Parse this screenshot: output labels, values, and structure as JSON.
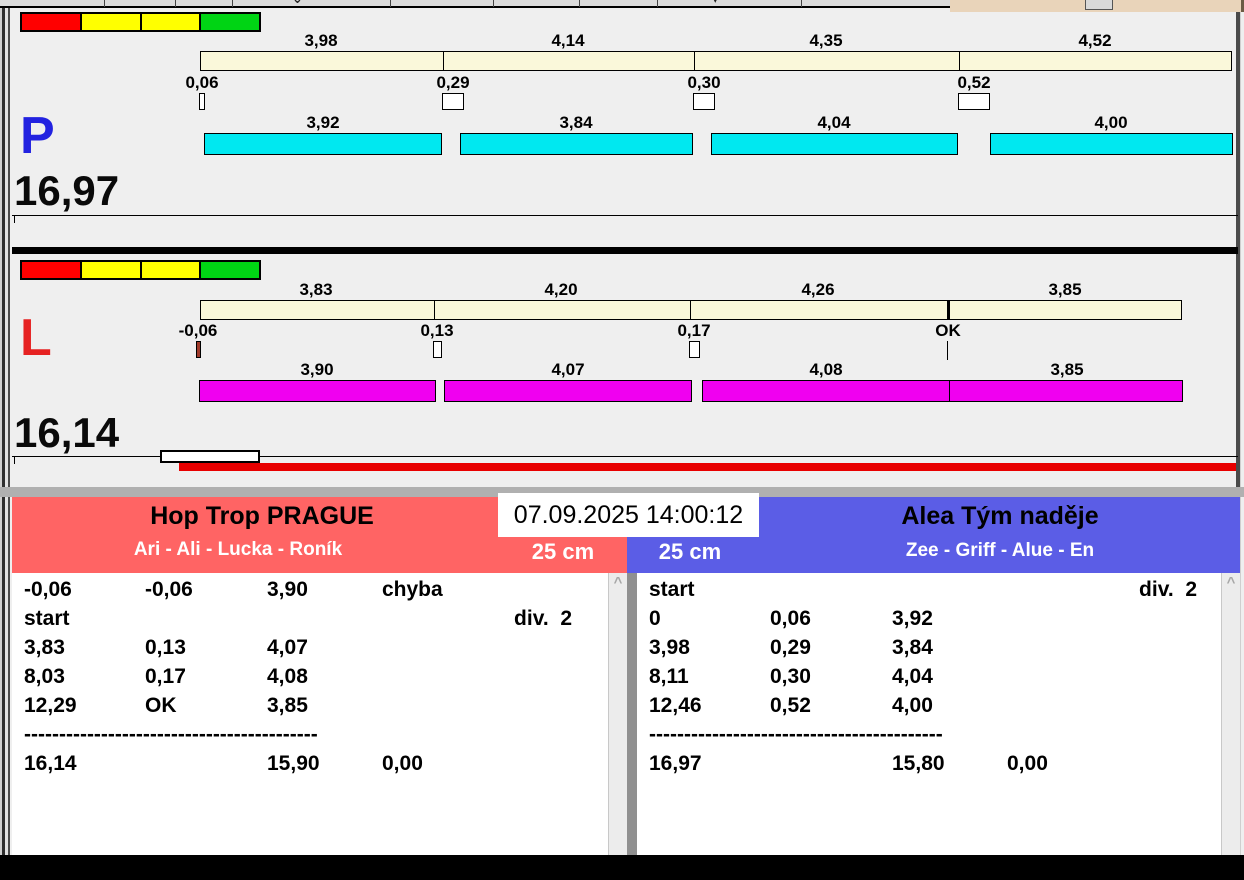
{
  "colors": {
    "upper_bar": "#faf8da",
    "lane_p_bar": "#00e8f0",
    "lane_l_bar": "#f000f0",
    "lane_p_letter": "#2222e0",
    "lane_l_letter": "#e62222",
    "team_left_bg": "#ff6464",
    "team_right_bg": "#5b5de6",
    "traffic_lights": [
      "#ff0000",
      "#ffff00",
      "#ffff00",
      "#00d414"
    ],
    "progress_bar_red": "#e80000",
    "negative_exchange_fill": "#a03a2a"
  },
  "lanes": [
    {
      "letter": "P",
      "total": "16,97",
      "upper_segments": [
        "3,98",
        "4,14",
        "4,35",
        "4,52"
      ],
      "exchanges": [
        "0,06",
        "0,29",
        "0,30",
        "0,52"
      ],
      "lower_segments": [
        "3,92",
        "3,84",
        "4,04",
        "4,00"
      ]
    },
    {
      "letter": "L",
      "total": "16,14",
      "upper_segments": [
        "3,83",
        "4,20",
        "4,26",
        "3,85"
      ],
      "exchanges": [
        "-0,06",
        "0,13",
        "0,17",
        "OK"
      ],
      "lower_segments": [
        "3,90",
        "4,07",
        "4,08",
        "3,85"
      ]
    }
  ],
  "datetime": "07.09.2025 14:00:12",
  "teams": [
    {
      "name": "Hop Trop PRAGUE",
      "members": "Ari - Ali - Lucka - Roník",
      "distance": "25 cm",
      "rows": [
        [
          "-0,06",
          "-0,06",
          "3,90",
          "chyba",
          ""
        ],
        [
          "start",
          "",
          "",
          "",
          "div.  2"
        ],
        [
          "3,83",
          "0,13",
          "4,07",
          "",
          ""
        ],
        [
          "8,03",
          "0,17",
          "4,08",
          "",
          ""
        ],
        [
          "12,29",
          "OK",
          "3,85",
          "",
          ""
        ],
        [
          "------------------------------------------",
          "",
          "",
          "",
          ""
        ],
        [
          "16,14",
          "",
          "15,90",
          "0,00",
          ""
        ]
      ]
    },
    {
      "name": "Alea Tým naděje",
      "members": "Zee - Griff - Alue - En",
      "distance": "25 cm",
      "rows": [
        [
          "start",
          "",
          "",
          "",
          "div.  2"
        ],
        [
          "0",
          "0,06",
          "3,92",
          "",
          ""
        ],
        [
          "3,98",
          "0,29",
          "3,84",
          "",
          ""
        ],
        [
          "8,11",
          "0,30",
          "4,04",
          "",
          ""
        ],
        [
          "12,46",
          "0,52",
          "4,00",
          "",
          ""
        ],
        [
          "------------------------------------------",
          "",
          "",
          "",
          ""
        ],
        [
          "16,97",
          "",
          "15,80",
          "0,00",
          ""
        ]
      ]
    }
  ],
  "scroll": {
    "up_arrow": "^"
  }
}
